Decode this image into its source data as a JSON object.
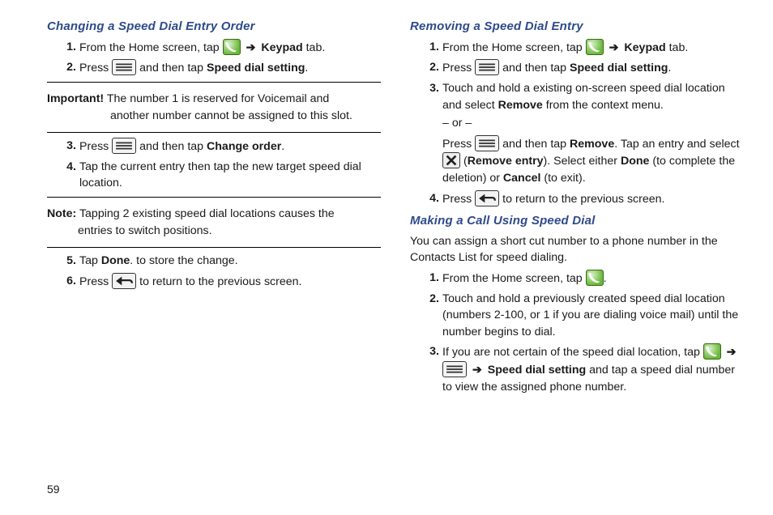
{
  "page_number": "59",
  "arrow": "➔",
  "left": {
    "heading": "Changing a Speed Dial Entry Order",
    "s1a": "From the Home screen, tap ",
    "s1b": " Keypad",
    "s1c": " tab.",
    "s2a": "Press ",
    "s2b": " and then tap ",
    "s2c": "Speed dial setting",
    "s2d": ".",
    "important_label": "Important!",
    "important_a": " The number 1 is reserved for Voicemail and ",
    "important_b": "another number cannot be assigned to this slot.",
    "s3a": "Press ",
    "s3b": " and then tap ",
    "s3c": "Change order",
    "s3d": ".",
    "s4": "Tap the current entry then tap the new target speed dial location.",
    "note_label": "Note:",
    "note_a": " Tapping 2 existing speed dial locations causes the ",
    "note_b": "entries to switch positions.",
    "s5a": "Tap ",
    "s5b": "Done",
    "s5c": ". to store the change.",
    "s6a": "Press ",
    "s6b": " to return to the previous screen."
  },
  "right": {
    "heading1": "Removing a Speed Dial Entry",
    "r1a": "From the Home screen, tap ",
    "r1b": " Keypad",
    "r1c": " tab.",
    "r2a": "Press ",
    "r2b": " and then tap ",
    "r2c": "Speed dial setting",
    "r2d": ".",
    "r3a": "Touch and hold a existing on-screen speed dial location and select ",
    "r3b": "Remove",
    "r3c": " from the context menu.",
    "r3or": "– or –",
    "r3d": "Press ",
    "r3e": " and then tap ",
    "r3f": "Remove",
    "r3g": ". Tap an entry and select ",
    "r3h": " (",
    "r3i": "Remove entry",
    "r3j": "). Select either ",
    "r3k": "Done",
    "r3l": " (to complete the deletion) or ",
    "r3m": "Cancel",
    "r3n": " (to exit).",
    "r4a": "Press ",
    "r4b": " to return to the previous screen.",
    "heading2": "Making a Call Using Speed Dial",
    "intro": "You can assign a short cut number to a phone number in the Contacts List for speed dialing.",
    "m1a": "From the Home screen, tap ",
    "m1b": ".",
    "m2": "Touch and hold a previously created speed dial location (numbers 2-100, or 1 if you are dialing voice mail) until the number begins to dial.",
    "m3a": "If you are not certain of the speed dial location, tap ",
    "m3b": " Speed dial setting",
    "m3c": " and tap a speed dial number to view the assigned phone number."
  }
}
